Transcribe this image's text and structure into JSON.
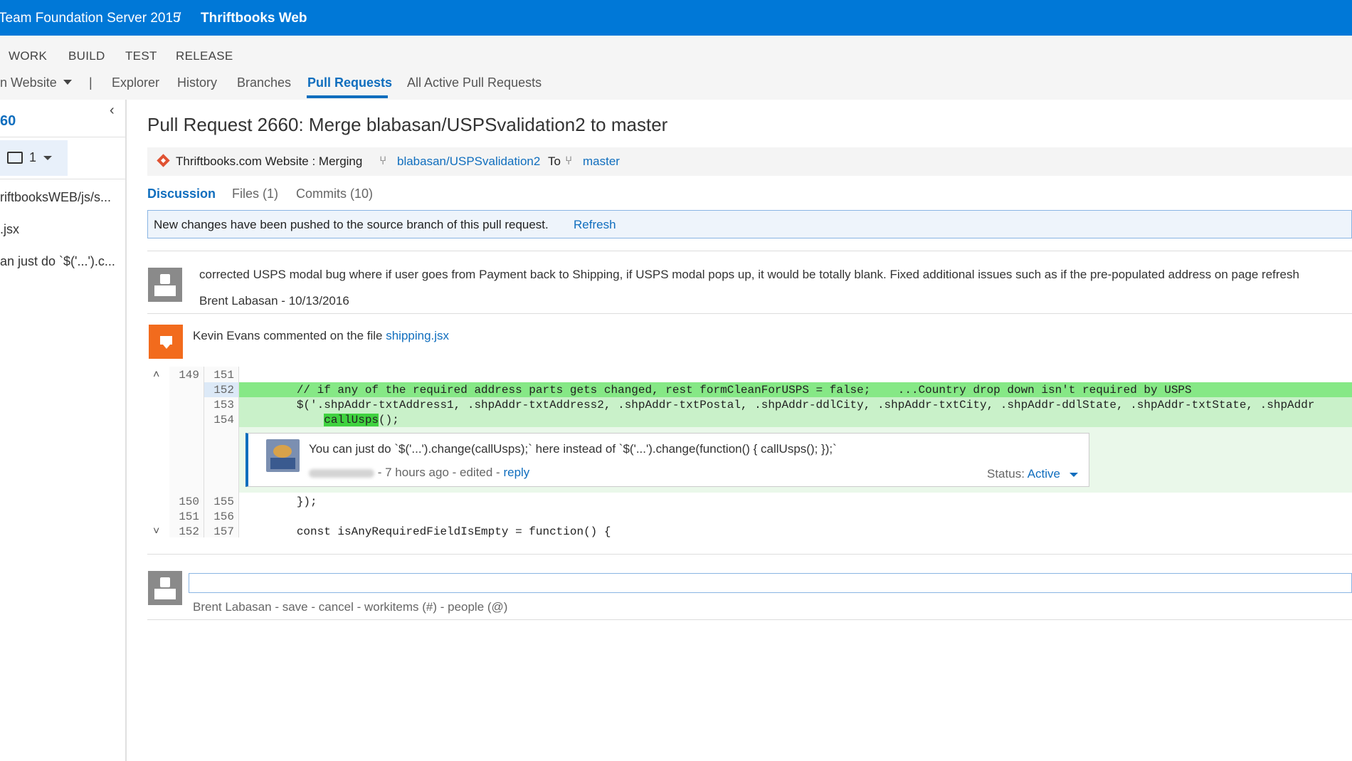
{
  "topbar": {
    "server": "Team Foundation Server 2015",
    "separator": "/",
    "project": "Thriftbooks Web"
  },
  "hub_menu": [
    "WORK",
    "BUILD",
    "TEST",
    "RELEASE"
  ],
  "subnav": {
    "repo": "n Website",
    "pipe": "|",
    "items": [
      "Explorer",
      "History",
      "Branches",
      "Pull Requests",
      "All Active Pull Requests"
    ],
    "active": "Pull Requests"
  },
  "left_panel": {
    "pr_number": "60",
    "collapse_glyph": "‹",
    "comment_count": "1",
    "items": [
      "riftbooksWEB/js/s...",
      ".jsx",
      "an just do `$('...').c..."
    ]
  },
  "pr": {
    "title": "Pull Request 2660: Merge blabasan/USPSvalidation2 to master",
    "repo_label": "Thriftbooks.com Website : Merging",
    "source_branch": "blabasan/USPSvalidation2",
    "to_label": "To",
    "target_branch": "master"
  },
  "tabs": [
    "Discussion",
    "Files (1)",
    "Commits (10)"
  ],
  "notice": {
    "text": "New changes have been pushed to the source branch of this pull request.",
    "link": "Refresh"
  },
  "description": {
    "text": "corrected USPS modal bug where if user goes from Payment back to Shipping, if USPS modal pops up, it would be totally blank. Fixed additional issues such as if the pre-populated address on page refresh",
    "author_line": "Brent Labasan - 10/13/2016"
  },
  "file_comment": {
    "prefix": "Kevin Evans commented on the file",
    "file": "shipping.jsx"
  },
  "code": {
    "rows": [
      {
        "old": "149",
        "new": "151",
        "text": ""
      },
      {
        "old": "",
        "new": "152",
        "text": "        // if any of the required address parts gets changed, rest formCleanForUSPS = false;    ...Country drop down isn't required by USPS"
      },
      {
        "old": "",
        "new": "153",
        "text": "        $('.shpAddr-txtAddress1, .shpAddr-txtAddress2, .shpAddr-txtPostal, .shpAddr-ddlCity, .shpAddr-txtCity, .shpAddr-ddlState, .shpAddr-txtState, .shpAddr"
      },
      {
        "old": "",
        "new": "154",
        "text_pre": "            ",
        "highlight": "callUsps",
        "text_post": "();"
      },
      {
        "old": "150",
        "new": "155",
        "text": "        });"
      },
      {
        "old": "151",
        "new": "156",
        "text": ""
      },
      {
        "old": "152",
        "new": "157",
        "text": "        const isAnyRequiredFieldIsEmpty = function() {"
      }
    ]
  },
  "inline_comment": {
    "text": "You can just do `$('...').change(callUsps);` here instead of `$('...').change(function() { callUsps(); });`",
    "meta": "- 7 hours ago - edited -",
    "reply": "reply",
    "status_label": "Status:",
    "status_value": "Active"
  },
  "reply_box": {
    "author": "Brent Labasan",
    "actions": [
      "save",
      "cancel",
      "workitems (#)",
      "people (@)"
    ],
    "sep": " - "
  },
  "colors": {
    "accent": "#0078d7",
    "link": "#106ebe",
    "added": "#c9f1c9",
    "highlight": "#3fd23f",
    "comment_icon": "#f26b1d"
  }
}
